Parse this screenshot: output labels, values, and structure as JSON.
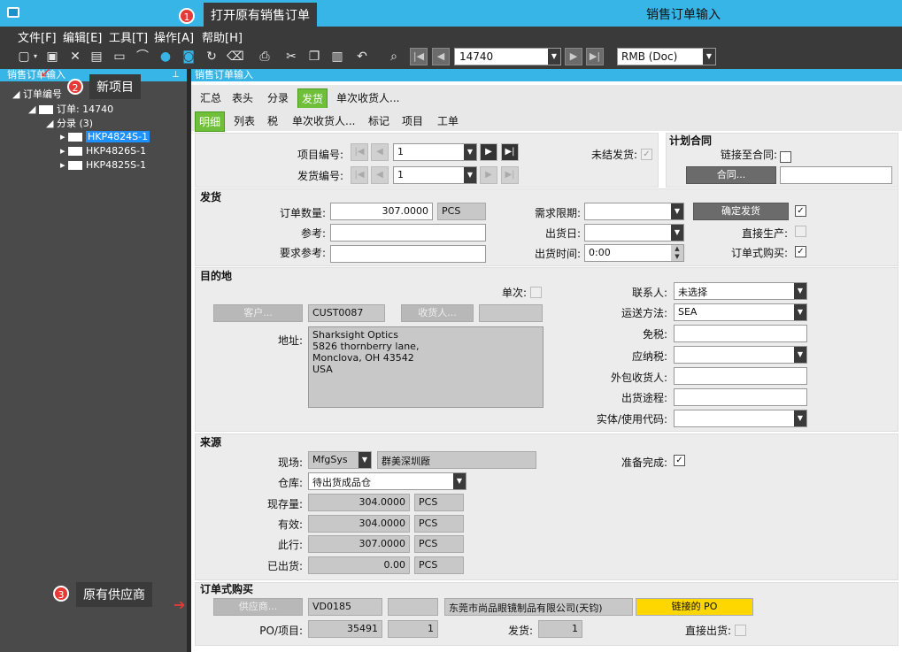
{
  "window": {
    "title": "销售订单输入"
  },
  "menu": [
    "文件[F]",
    "编辑[E]",
    "工具[T]",
    "操作[A]",
    "帮助[H]"
  ],
  "toolbar": {
    "record_value": "14740",
    "currency": "RMB (Doc)"
  },
  "left_panel": {
    "header": "销售订单输入",
    "tree": {
      "root": "订单编号",
      "order": "订单: 14740",
      "releases": "分录 (3)",
      "items": [
        "HKP4824S-1",
        "HKP4826S-1",
        "HKP4825S-1"
      ]
    }
  },
  "right_panel": {
    "header": "销售订单输入"
  },
  "tabs_top": [
    "汇总",
    "表头",
    "分录",
    "发货",
    "单次收货人..."
  ],
  "tabs_sub": [
    "明细",
    "列表",
    "税",
    "单次收货人...",
    "标记",
    "项目",
    "工单"
  ],
  "release": {
    "item_no_label": "项目编号:",
    "item_no": "1",
    "ship_no_label": "发货编号:",
    "ship_no": "1",
    "unfinished_label": "未结发货:"
  },
  "plan_contract": {
    "title": "计划合同",
    "link_label": "链接至合同:",
    "contract_btn": "合同..."
  },
  "shipping": {
    "title": "发货",
    "order_qty_label": "订单数量:",
    "order_qty": "307.0000",
    "uom": "PCS",
    "ref_label": "参考:",
    "req_ref_label": "要求参考:",
    "need_by_label": "需求限期:",
    "ship_date_label": "出货日:",
    "ship_time_label": "出货时间:",
    "ship_time": "0:00",
    "firm_btn": "确定发货",
    "direct_prod_label": "直接生产:",
    "buy_to_order_label": "订单式购买:"
  },
  "destination": {
    "title": "目的地",
    "one_time_label": "单次:",
    "customer_btn": "客户...",
    "customer": "CUST0087",
    "shipto_btn": "收货人...",
    "address_label": "地址:",
    "address_lines": [
      "Sharksight Optics",
      "5826 thornberry lane,",
      "Monclova,  OH 43542",
      "USA"
    ],
    "contact_label": "联系人:",
    "contact": "未选择",
    "ship_via_label": "运送方法:",
    "ship_via": "SEA",
    "tax_exempt_label": "免税:",
    "taxable_label": "应纳税:",
    "third_party_label": "外包收货人:",
    "ship_route_label": "出货途程:",
    "entity_use_label": "实体/使用代码:"
  },
  "source": {
    "title": "来源",
    "site_label": "现场:",
    "site": "MfgSys",
    "site_name": "群美深圳厰",
    "warehouse_label": "仓库:",
    "warehouse": "待出货成品仓",
    "onhand_label": "现存量:",
    "onhand": "304.0000",
    "avail_label": "有效:",
    "avail": "304.0000",
    "thisline_label": "此行:",
    "thisline": "307.0000",
    "shipped_label": "已出货:",
    "shipped": "0.00",
    "uom": "PCS",
    "ready_label": "准备完成:"
  },
  "buy_to_order": {
    "title": "订单式购买",
    "supplier_btn": "供应商...",
    "supplier": "VD0185",
    "supplier_name": "东莞市尚品眼镜制品有限公司(天钧)",
    "linked_po_btn": "链接的 PO",
    "po_line_label": "PO/项目:",
    "po": "35491",
    "po_line": "1",
    "release_label": "发货:",
    "release": "1",
    "drop_ship_label": "直接出货:"
  },
  "callouts": {
    "c1": "打开原有销售订单",
    "c2": "新项目",
    "c3": "原有供应商"
  },
  "colors": {
    "accent": "#37b5e6",
    "dark": "#3a3a3a",
    "tab_active": "#6fbf3a",
    "po_button": "#ffd700",
    "badge": "#e53935"
  }
}
